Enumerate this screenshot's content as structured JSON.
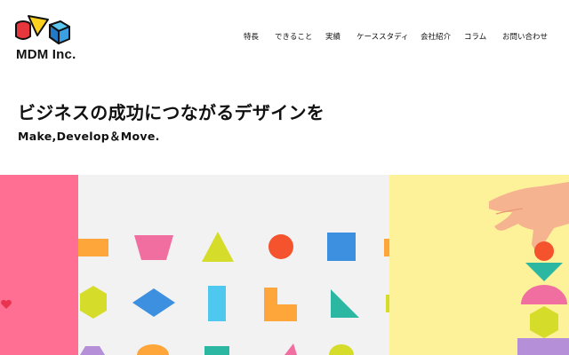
{
  "header": {
    "brand": "MDM Inc.",
    "logo_icon": "blocks-logo-icon",
    "nav": [
      {
        "id": "features",
        "label": "特長"
      },
      {
        "id": "services",
        "label": "できること"
      },
      {
        "id": "works",
        "label": "実績"
      },
      {
        "id": "case-study",
        "label": "ケーススタディ"
      },
      {
        "id": "company",
        "label": "会社紹介"
      },
      {
        "id": "column",
        "label": "コラム"
      },
      {
        "id": "contact",
        "label": "お問い合わせ"
      }
    ]
  },
  "hero": {
    "headline": "ビジネスの成功につながるデザインを",
    "subline": "Make,Develop＆Move."
  },
  "colors": {
    "pink": "#ff6f93",
    "grey": "#f2f2f2",
    "yellow": "#fdf19a",
    "orange": "#ffa63a",
    "red": "#f5522e",
    "blue": "#3d8fe0",
    "cyan": "#4fc8f0",
    "lime": "#d6dc2a",
    "teal": "#2cb7a3",
    "magenta": "#f06fa0"
  },
  "icons": [
    "blocks-logo-icon",
    "heart-icon",
    "geometric-shapes-illustration",
    "hand-stacking-shapes-illustration"
  ]
}
